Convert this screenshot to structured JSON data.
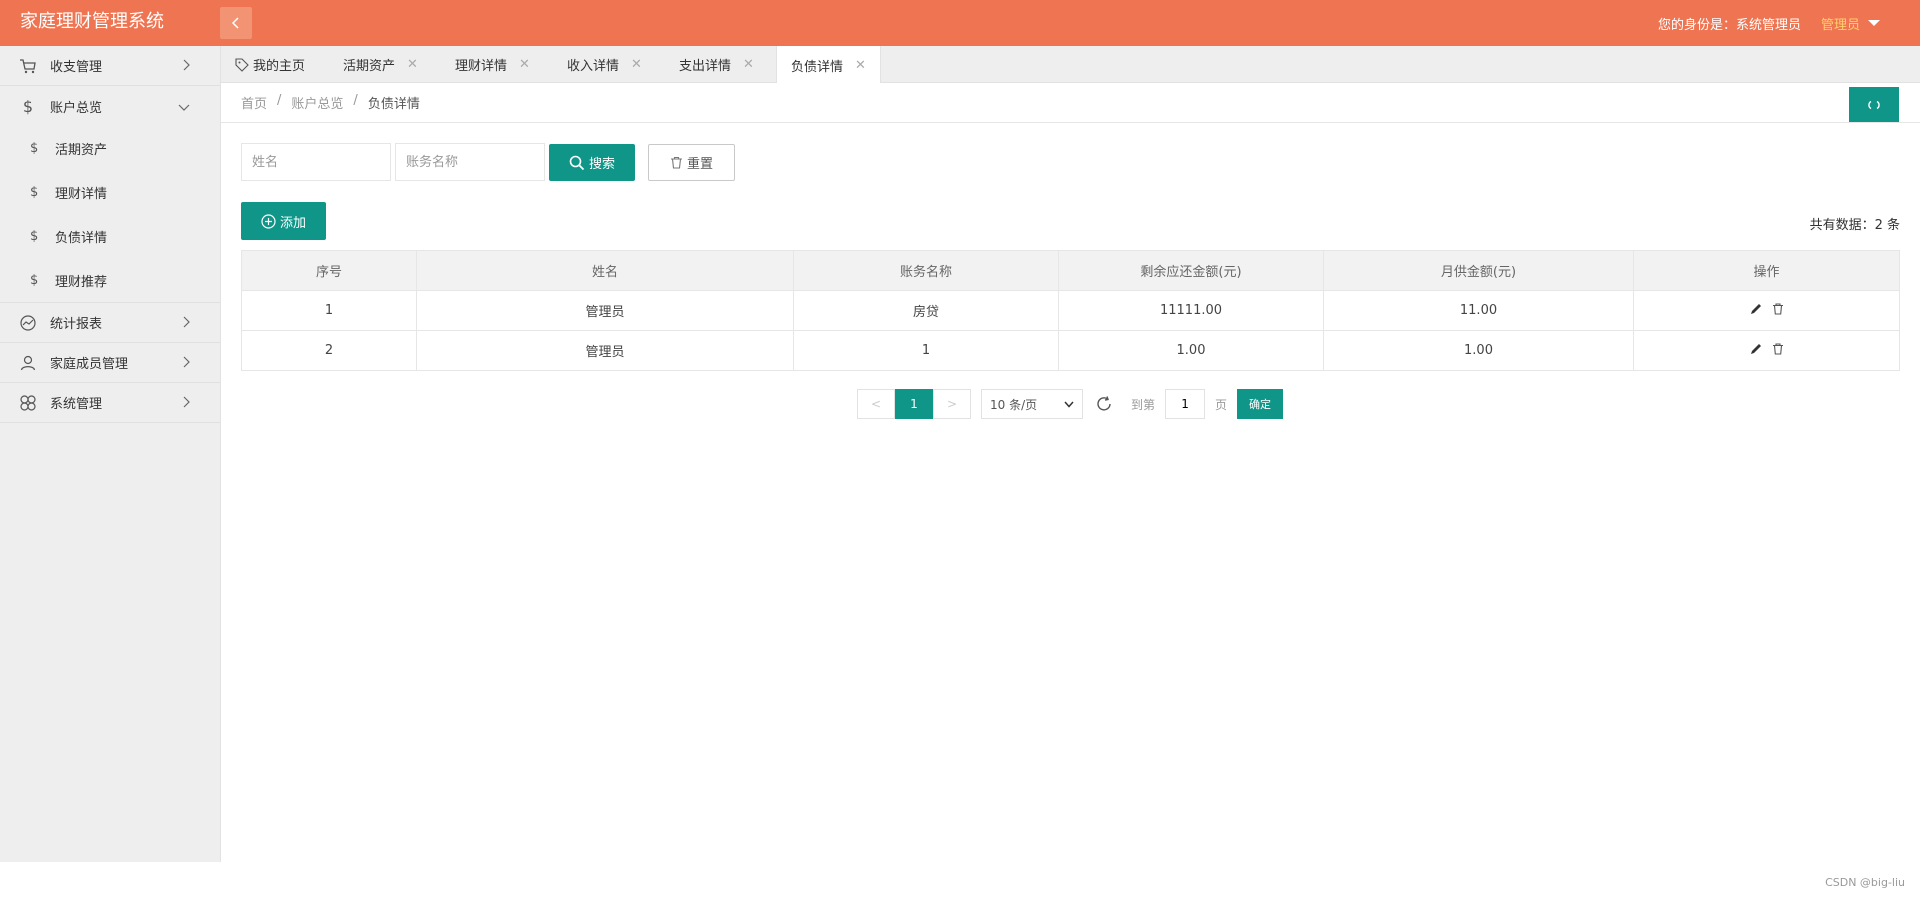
{
  "app": {
    "title": "家庭理财管理系统"
  },
  "header": {
    "identity_label": "您的身份是：系统管理员",
    "user_name": "管理员"
  },
  "sidebar": {
    "items": [
      {
        "label": "收支管理",
        "icon": "cart-icon"
      },
      {
        "label": "账户总览",
        "icon": "dollar-icon",
        "children": [
          {
            "label": "活期资产"
          },
          {
            "label": "理财详情"
          },
          {
            "label": "负债详情"
          },
          {
            "label": "理财推荐"
          }
        ]
      },
      {
        "label": "统计报表",
        "icon": "chart-icon"
      },
      {
        "label": "家庭成员管理",
        "icon": "user-icon"
      },
      {
        "label": "系统管理",
        "icon": "flower-icon"
      }
    ],
    "sub_icon": "$"
  },
  "tabs": [
    {
      "label": "我的主页"
    },
    {
      "label": "活期资产"
    },
    {
      "label": "理财详情"
    },
    {
      "label": "收入详情"
    },
    {
      "label": "支出详情"
    },
    {
      "label": "负债详情"
    }
  ],
  "breadcrumb": {
    "home": "首页",
    "level2": "账户总览",
    "current": "负债详情",
    "sep": "/"
  },
  "search": {
    "name_placeholder": "姓名",
    "account_placeholder": "账务名称",
    "search_label": "搜索",
    "reset_label": "重置"
  },
  "toolbar": {
    "add_label": "添加",
    "total_text": "共有数据：2 条"
  },
  "table": {
    "headers": [
      "序号",
      "姓名",
      "账务名称",
      "剩余应还金额(元)",
      "月供金额(元)",
      "操作"
    ],
    "rows": [
      [
        "1",
        "管理员",
        "房贷",
        "11111.00",
        "11.00"
      ],
      [
        "2",
        "管理员",
        "1",
        "1.00",
        "1.00"
      ]
    ]
  },
  "pagination": {
    "prev": "<",
    "next": ">",
    "current": "1",
    "page_size": "10 条/页",
    "goto_label": "到第",
    "goto_value": "1",
    "page_unit": "页",
    "confirm_label": "确定"
  },
  "watermark": "CSDN @big-liu",
  "colors": {
    "header": "#ef7552",
    "accent": "#109688",
    "user": "#ffd06b"
  }
}
